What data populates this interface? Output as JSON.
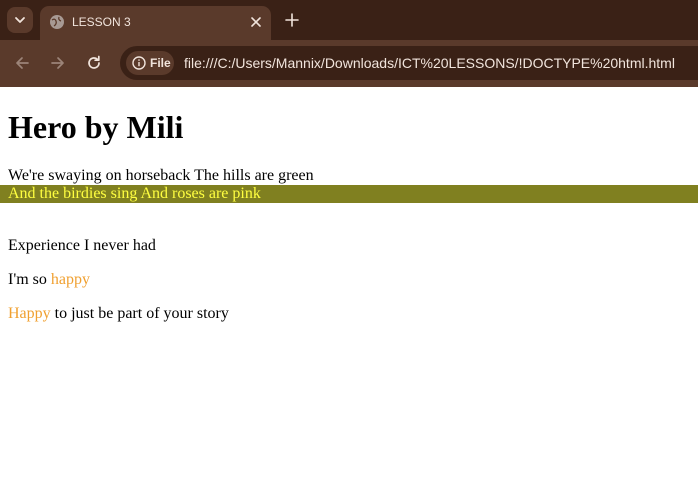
{
  "browser": {
    "tab": {
      "title": "LESSON 3",
      "favicon": "globe-icon"
    },
    "address": {
      "scheme_chip": "File",
      "url": "file:///C:/Users/Mannix/Downloads/ICT%20LESSONS/!DOCTYPE%20html.html"
    },
    "colors": {
      "frame": "#3a2116",
      "toolbar": "#5a3a2b",
      "text": "#f1e4dc"
    }
  },
  "page": {
    "title": "Hero by Mili",
    "line1": "We're swaying on horseback The hills are green",
    "highlight_line": "And the birdies sing And roses are pink",
    "line3": "Experience I never had",
    "line4_prefix": "I'm so ",
    "line4_word": "happy",
    "line5_word": "Happy",
    "line5_suffix": " to just be part of your story",
    "colors": {
      "highlight_bg": "#808020",
      "highlight_text": "#ffff40",
      "accent": "#f0a030"
    }
  }
}
